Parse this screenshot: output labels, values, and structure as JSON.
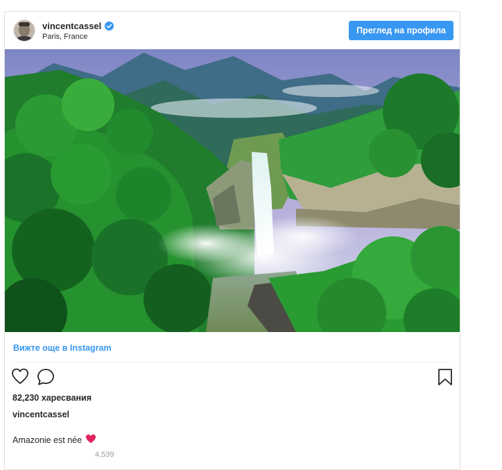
{
  "post": {
    "username": "vincentcassel",
    "verified": true,
    "location": "Paris, France",
    "profile_button_label": "Преглед на профила",
    "see_more_link": "Вижте още в Instagram",
    "likes_text": "82,230 харесвания",
    "caption_username": "vincentcassel",
    "caption_text": "Amazonie est née",
    "caption_emoji": "heart-emoji",
    "partial_bottom_text": "4,539"
  },
  "icons": {
    "like": "heart-outline-icon",
    "comment": "comment-bubble-icon",
    "save": "bookmark-icon",
    "verified": "verified-badge-icon"
  },
  "colors": {
    "accent": "#3897f0",
    "text": "#262626",
    "border": "#dbdbdb",
    "heart_emoji": "#e0245e"
  }
}
